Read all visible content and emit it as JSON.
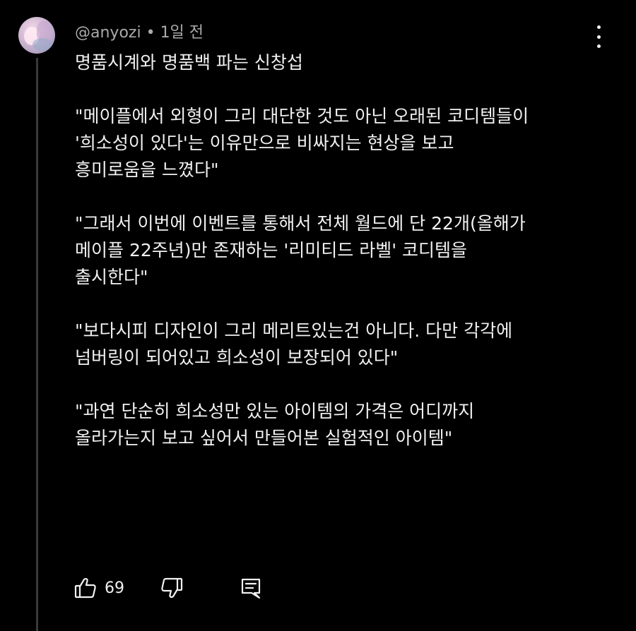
{
  "comment": {
    "author": "@anyozi",
    "separator": "•",
    "time": "1일 전",
    "title": "명품시계와 명품백 파는 신창섭",
    "paragraphs": [
      [
        "\"메이플에서 외형이 그리 대단한 것도 아닌 오래된 코디템들이",
        "'희소성이 있다'는 이유만으로 비싸지는 현상을 보고",
        "흥미로움을 느꼈다\""
      ],
      [
        "\"그래서 이번에 이벤트를 통해서 전체 월드에 단 22개(올해가",
        "메이플 22주년)만 존재하는 '리미티드 라벨' 코디템을",
        "출시한다\""
      ],
      [
        "\"보다시피 디자인이 그리 메리트있는건 아니다. 다만 각각에",
        "넘버링이 되어있고 희소성이 보장되어 있다\""
      ],
      [
        "\"과연 단순히 희소성만 있는 아이템의 가격은 어디까지",
        "올라가는지 보고 싶어서 만들어본 실험적인 아이템\""
      ]
    ],
    "like_count": "69"
  },
  "icons": {
    "avatar": "user-avatar",
    "more": "more-vertical-icon",
    "like": "thumbs-up-icon",
    "dislike": "thumbs-down-icon",
    "reply": "reply-icon"
  },
  "colors": {
    "background": "#000000",
    "text": "#f1f1f1",
    "meta_text": "#aaaaaa",
    "thread_line": "#3a3a3a"
  }
}
